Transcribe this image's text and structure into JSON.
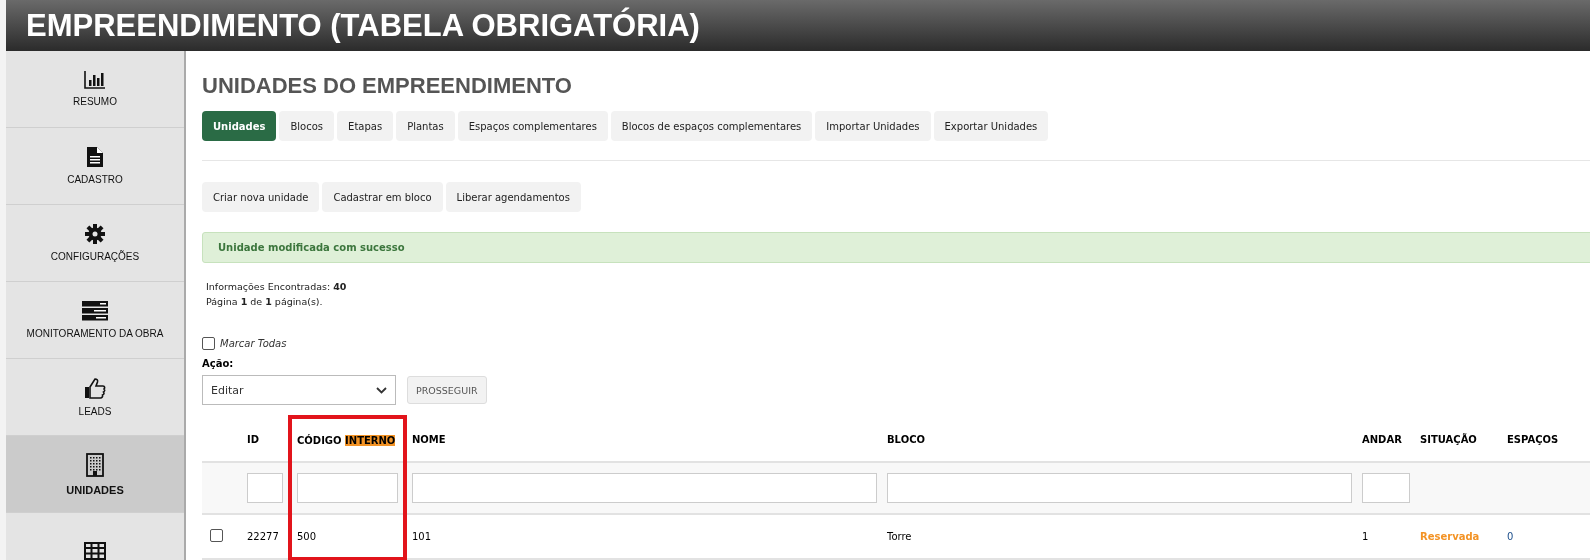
{
  "header": {
    "title": "EMPREENDIMENTO (TABELA OBRIGATÓRIA)"
  },
  "sidebar": {
    "items": [
      {
        "label": "RESUMO",
        "selected": false
      },
      {
        "label": "CADASTRO",
        "selected": false
      },
      {
        "label": "CONFIGURAÇÕES",
        "selected": false
      },
      {
        "label": "MONITORAMENTO DA OBRA",
        "selected": false
      },
      {
        "label": "LEADS",
        "selected": false
      },
      {
        "label": "UNIDADES",
        "selected": true
      },
      {
        "selected": false
      }
    ]
  },
  "page_title": "UNIDADES DO EMPREENDIMENTO",
  "tabs": [
    {
      "label": "Unidades",
      "selected": true
    },
    {
      "label": "Blocos",
      "selected": false
    },
    {
      "label": "Etapas",
      "selected": false
    },
    {
      "label": "Plantas",
      "selected": false
    },
    {
      "label": "Espaços complementares",
      "selected": false
    },
    {
      "label": "Blocos de espaços complementares",
      "selected": false
    },
    {
      "label": "Importar Unidades",
      "selected": false
    },
    {
      "label": "Exportar Unidades",
      "selected": false
    }
  ],
  "actions": [
    "Criar nova unidade",
    "Cadastrar em bloco",
    "Liberar agendamentos"
  ],
  "alert": "Unidade modificada com sucesso",
  "info": [
    "Informações Encontradas: **40**",
    "Página **1** de **1** página(s)."
  ],
  "select_all": {
    "label": "Marcar Todas",
    "checked": false
  },
  "action_select": {
    "label": "Ação:",
    "value": "Editar"
  },
  "proceed_button": "PROSSEGUIR",
  "table": {
    "columns": [
      {
        "kind": "filter",
        "label": "ID"
      },
      {
        "kind": "filter",
        "label": "CÓDIGO",
        "highlighted_word": "INTERNO",
        "framed": true
      },
      {
        "kind": "filter",
        "label": "NOME"
      },
      {
        "kind": "filter",
        "label": "BLOCO"
      },
      {
        "kind": "filter",
        "label": "ANDAR"
      },
      {
        "kind": "status",
        "label": "SITUAÇÃO"
      },
      {
        "kind": "plain",
        "label": "ESPAÇOS"
      }
    ],
    "rows": [
      {
        "checked": false,
        "cells": [
          "22277",
          "500",
          "101",
          "Torre",
          "1",
          "Reservada",
          "0"
        ],
        "color": "#f39325"
      }
    ]
  }
}
